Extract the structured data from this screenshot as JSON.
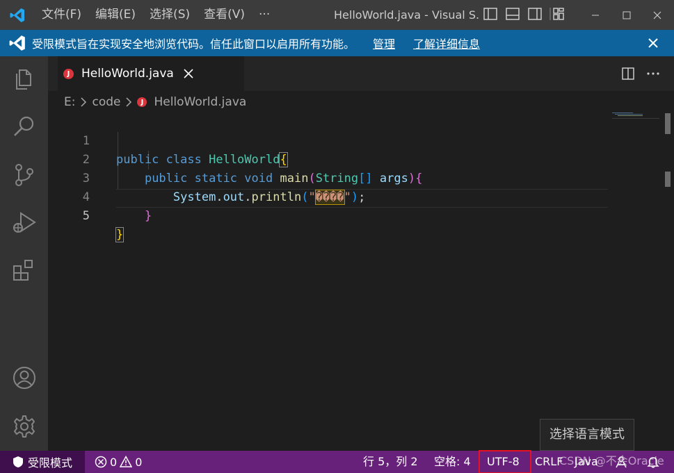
{
  "titlebar": {
    "menu": [
      "文件(F)",
      "编辑(E)",
      "选择(S)",
      "查看(V)"
    ],
    "more": "···",
    "title": "HelloWorld.java - Visual S..."
  },
  "banner": {
    "text": "受限模式旨在实现安全地浏览代码。信任此窗口以启用所有功能。",
    "manage_link": "管理",
    "learn_more_link": "了解详细信息"
  },
  "tabs": [
    {
      "label": "HelloWorld.java",
      "badge": "J"
    }
  ],
  "breadcrumb": {
    "drive": "E:",
    "folder": "code",
    "file": "HelloWorld.java",
    "badge": "J"
  },
  "code": {
    "line_numbers": [
      "1",
      "2",
      "3",
      "4",
      "5"
    ],
    "line1": {
      "kw1": "public",
      "kw2": "class",
      "cls": "HelloWorld",
      "brace": "{"
    },
    "line2": {
      "kw1": "public",
      "kw2": "static",
      "kw3": "void",
      "fn": "main",
      "p1": "(",
      "type": "String",
      "arr": "[]",
      "param": "args",
      "p2": ")",
      "brace": "{"
    },
    "line3": {
      "obj": "System",
      "dot1": ".",
      "field": "out",
      "dot2": ".",
      "fn": "println",
      "p1": "(",
      "q1": "\"",
      "str": "����",
      "q2": "\"",
      "p2": ")",
      "semi": ";"
    },
    "line4": {
      "brace": "}"
    },
    "line5": {
      "brace": "}"
    }
  },
  "tooltip": "选择语言模式",
  "statusbar": {
    "restricted": "受限模式",
    "errors": "0",
    "warnings": "0",
    "position": "行 5，列 2",
    "spaces": "空格: 4",
    "encoding": "UTF-8",
    "eol": "CRLF",
    "language": "Java"
  },
  "watermark": "CSDN @不会Oracle",
  "colors": {
    "titlebar": "#3c3c3c",
    "banner": "#0e639c",
    "activitybar": "#333333",
    "editor": "#1e1e1e",
    "statusbar": "#68217a",
    "restricted_bg": "#3e0f4c",
    "highlight": "#e81123"
  }
}
